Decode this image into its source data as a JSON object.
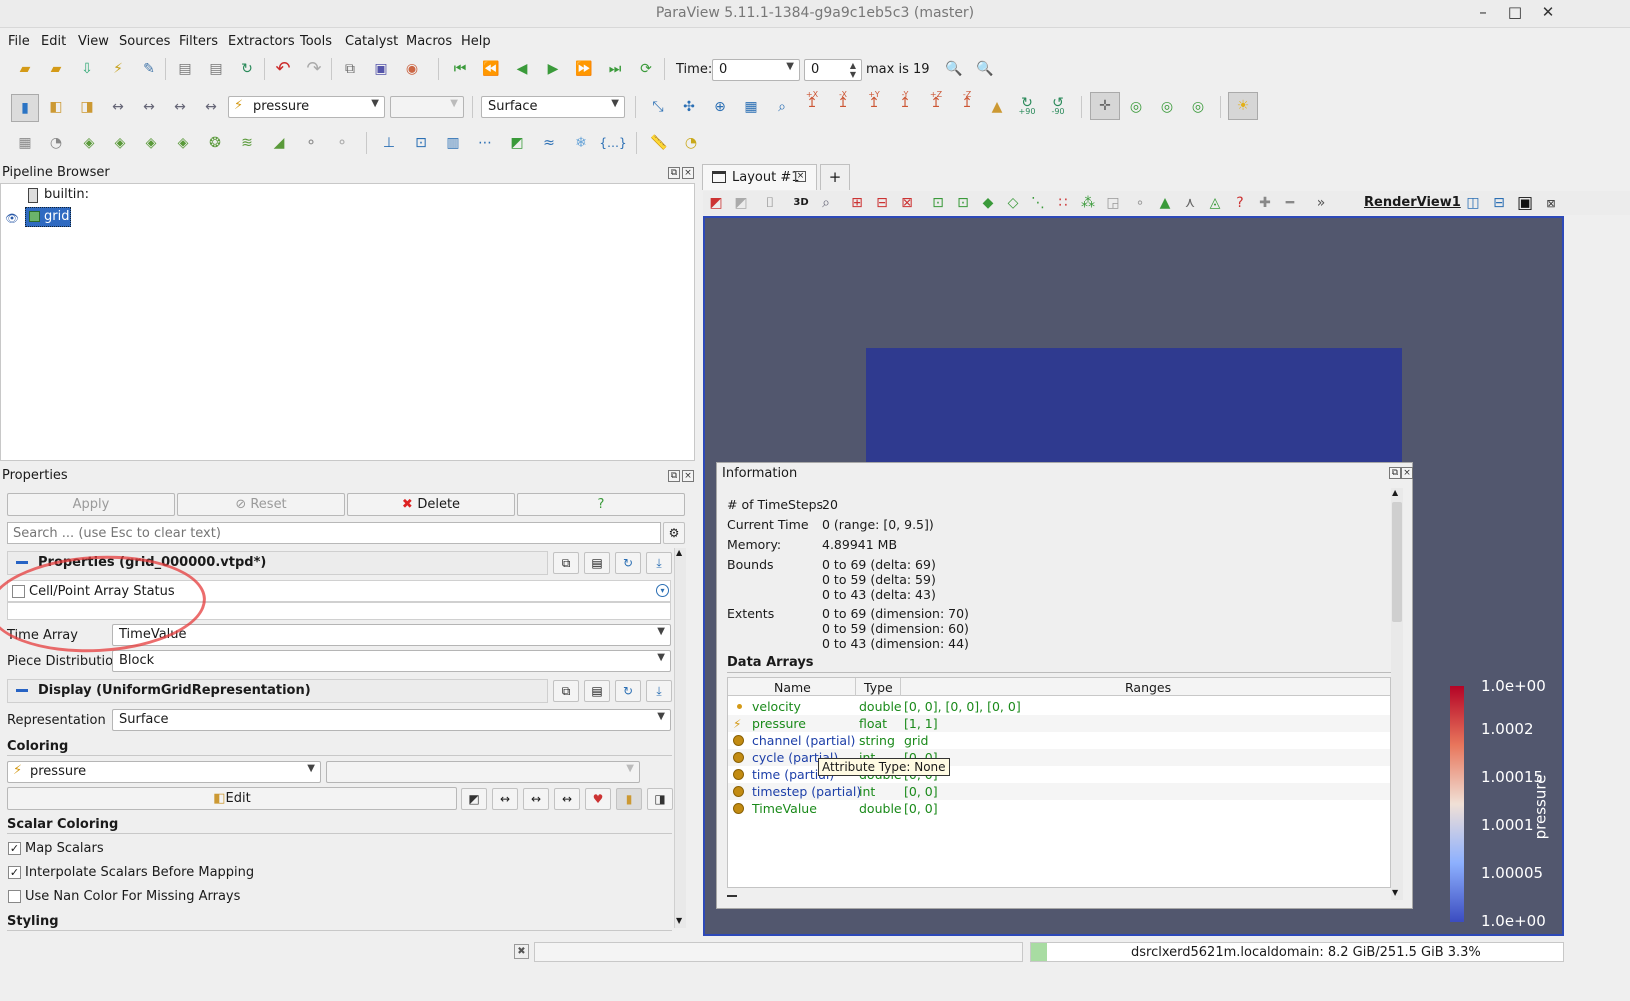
{
  "window": {
    "title": "ParaView 5.11.1-1384-g9a9c1eb5c3 (master)",
    "minimize": "–",
    "maximize": "□",
    "close": "✕"
  },
  "menu": [
    "File",
    "Edit",
    "View",
    "Sources",
    "Filters",
    "Extractors",
    "Tools",
    "Catalyst",
    "Macros",
    "Help"
  ],
  "time": {
    "label": "Time:",
    "value": "0",
    "step": "0",
    "max_label": "max is 19"
  },
  "toolbar2": {
    "color_by": "pressure",
    "component": "",
    "representation": "Surface"
  },
  "toolbar2_axes": [
    "+X",
    "-X",
    "+Y",
    "-Y",
    "+Z",
    "-Z",
    "+90",
    "-90"
  ],
  "pipeline": {
    "title": "Pipeline Browser",
    "root": "builtin:",
    "item": "grid"
  },
  "properties": {
    "title": "Properties",
    "apply": "Apply",
    "reset": "Reset",
    "delete": "Delete",
    "help": "?",
    "search_placeholder": "Search ... (use Esc to clear text)",
    "section1": "Properties (grid_000000.vtpd*)",
    "cell_point_status": "Cell/Point Array Status",
    "time_array_label": "Time Array",
    "time_array_value": "TimeValue",
    "piece_dist_label": "Piece Distribution",
    "piece_dist_value": "Block",
    "section2": "Display (UniformGridRepresentation)",
    "representation_label": "Representation",
    "representation_value": "Surface",
    "coloring_label": "Coloring",
    "coloring_value": "pressure",
    "edit": "Edit",
    "scalar_coloring_label": "Scalar Coloring",
    "map_scalars": "Map Scalars",
    "interpolate": "Interpolate Scalars Before Mapping",
    "nan_color": "Use Nan Color For Missing Arrays",
    "styling_label": "Styling"
  },
  "layout": {
    "tab": "Layout #1",
    "add": "+",
    "view_name": "RenderView1",
    "btn3d": "3D"
  },
  "information": {
    "title": "Information",
    "timesteps_label": "# of TimeSteps",
    "timesteps_value": "20",
    "current_time_label": "Current Time",
    "current_time_value": "0 (range: [0, 9.5])",
    "memory_label": "Memory:",
    "memory_value": "4.89941 MB",
    "bounds_label": "Bounds",
    "bounds": [
      "0 to 69 (delta: 69)",
      "0 to 59 (delta: 59)",
      "0 to 43 (delta: 43)"
    ],
    "extents_label": "Extents",
    "extents": [
      "0 to 69 (dimension: 70)",
      "0 to 59 (dimension: 60)",
      "0 to 43 (dimension: 44)"
    ],
    "data_arrays_label": "Data Arrays",
    "columns": [
      "Name",
      "Type",
      "Ranges"
    ],
    "arrays": [
      {
        "name": "velocity",
        "type": "double",
        "range": "[0, 0], [0, 0], [0, 0]",
        "color": "green"
      },
      {
        "name": "pressure",
        "type": "float",
        "range": "[1, 1]",
        "color": "green"
      },
      {
        "name": "channel (partial)",
        "type": "string",
        "range": "grid",
        "color": "blue"
      },
      {
        "name": "cycle (partial)",
        "type": "int",
        "range": "[0, 0]",
        "color": "blue"
      },
      {
        "name": "time (partial)",
        "type": "double",
        "range": "[0, 0]",
        "color": "blue"
      },
      {
        "name": "timestep (partial)",
        "type": "int",
        "range": "[0, 0]",
        "color": "blue"
      },
      {
        "name": "TimeValue",
        "type": "double",
        "range": "[0, 0]",
        "color": "green"
      }
    ],
    "tooltip": "Attribute Type: None"
  },
  "colorbar": {
    "title": "pressure",
    "labels": [
      "1.0e+00",
      "1.0002",
      "1.00015",
      "1.0001",
      "1.00005",
      "1.0e+00"
    ]
  },
  "status": {
    "memory": "dsrclxerd5621m.localdomain: 8.2 GiB/251.5 GiB 3.3%"
  },
  "colors": {
    "accent": "#2d49b8",
    "background": "#52576e",
    "surface": "#2f3a8f",
    "annotation": "#e63c3c"
  }
}
